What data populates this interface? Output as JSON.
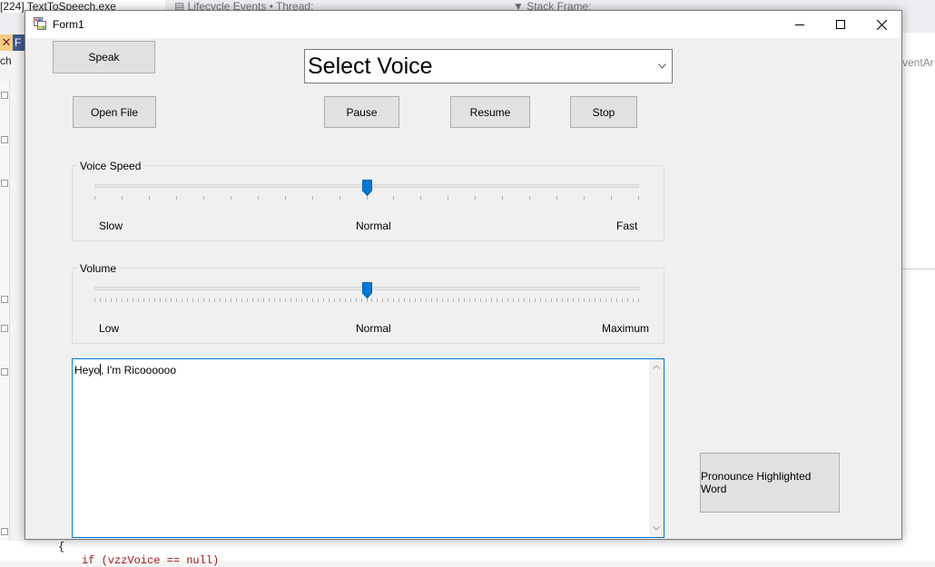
{
  "ide": {
    "tab_process": "[224] TextToSpeech.exe",
    "tab_lifecycle": "Lifecycle Events",
    "tab_thread": "Thread:",
    "tab_stackframe": "Stack Frame:",
    "side_tab": "F",
    "left_snippet": "ch",
    "right_snippet": "ventAr",
    "code_brace": "{",
    "code_line": "if (vzzVoice == null)"
  },
  "window": {
    "title": "Form1",
    "minimize_glyph": "—",
    "maximize_glyph": "☐",
    "close_glyph": "✕"
  },
  "buttons": {
    "speak": "Speak",
    "open_file": "Open File",
    "pause": "Pause",
    "resume": "Resume",
    "stop": "Stop",
    "pronounce": "Pronounce Highlighted Word"
  },
  "voice_select": {
    "selected": "Select Voice",
    "arrow": "⌄"
  },
  "voice_speed": {
    "group_label": "Voice Speed",
    "min_label": "Slow",
    "mid_label": "Normal",
    "max_label": "Fast",
    "value_fraction": 0.5
  },
  "volume": {
    "group_label": "Volume",
    "min_label": "Low",
    "mid_label": "Normal",
    "max_label": "Maximum",
    "value_fraction": 0.5
  },
  "text_box": {
    "text_before_caret": "Heyo",
    "text_after_caret": ", I'm Ricoooooo",
    "scroll_up": "˄",
    "scroll_down": "˅"
  },
  "colors": {
    "accent": "#0078d7",
    "button_face": "#e1e1e1",
    "window_bg": "#f0f0f0"
  }
}
